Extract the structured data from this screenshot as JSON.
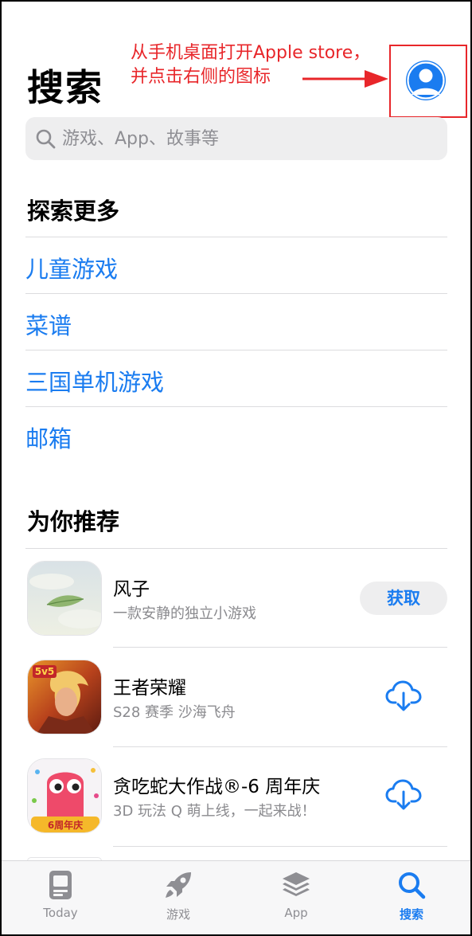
{
  "header": {
    "title": "搜索",
    "annotation_line1": "从手机桌面打开Apple store，",
    "annotation_line2": "并点击右侧的图标"
  },
  "search": {
    "placeholder": "游戏、App、故事等"
  },
  "explore": {
    "title": "探索更多",
    "items": [
      "儿童游戏",
      "菜谱",
      "三国单机游戏",
      "邮箱"
    ]
  },
  "recommend": {
    "title": "为你推荐",
    "apps": [
      {
        "name": "风子",
        "subtitle": "一款安静的独立小游戏",
        "action": "获取"
      },
      {
        "name": "王者荣耀",
        "subtitle": "S28 赛季 沙海飞舟",
        "icon_badge": "5v5"
      },
      {
        "name": "贪吃蛇大作战®-6 周年庆",
        "subtitle": "3D 玩法 Q 萌上线，一起来战！",
        "icon_badge": "6周年庆"
      }
    ]
  },
  "tabs": [
    {
      "label": "Today",
      "icon": "today-icon"
    },
    {
      "label": "游戏",
      "icon": "rocket-icon"
    },
    {
      "label": "App",
      "icon": "layers-icon"
    },
    {
      "label": "搜索",
      "icon": "search-icon",
      "active": true
    }
  ],
  "colors": {
    "accent": "#1a7cf0",
    "annotation": "#e8262a",
    "search_bg": "#eeeeef"
  }
}
